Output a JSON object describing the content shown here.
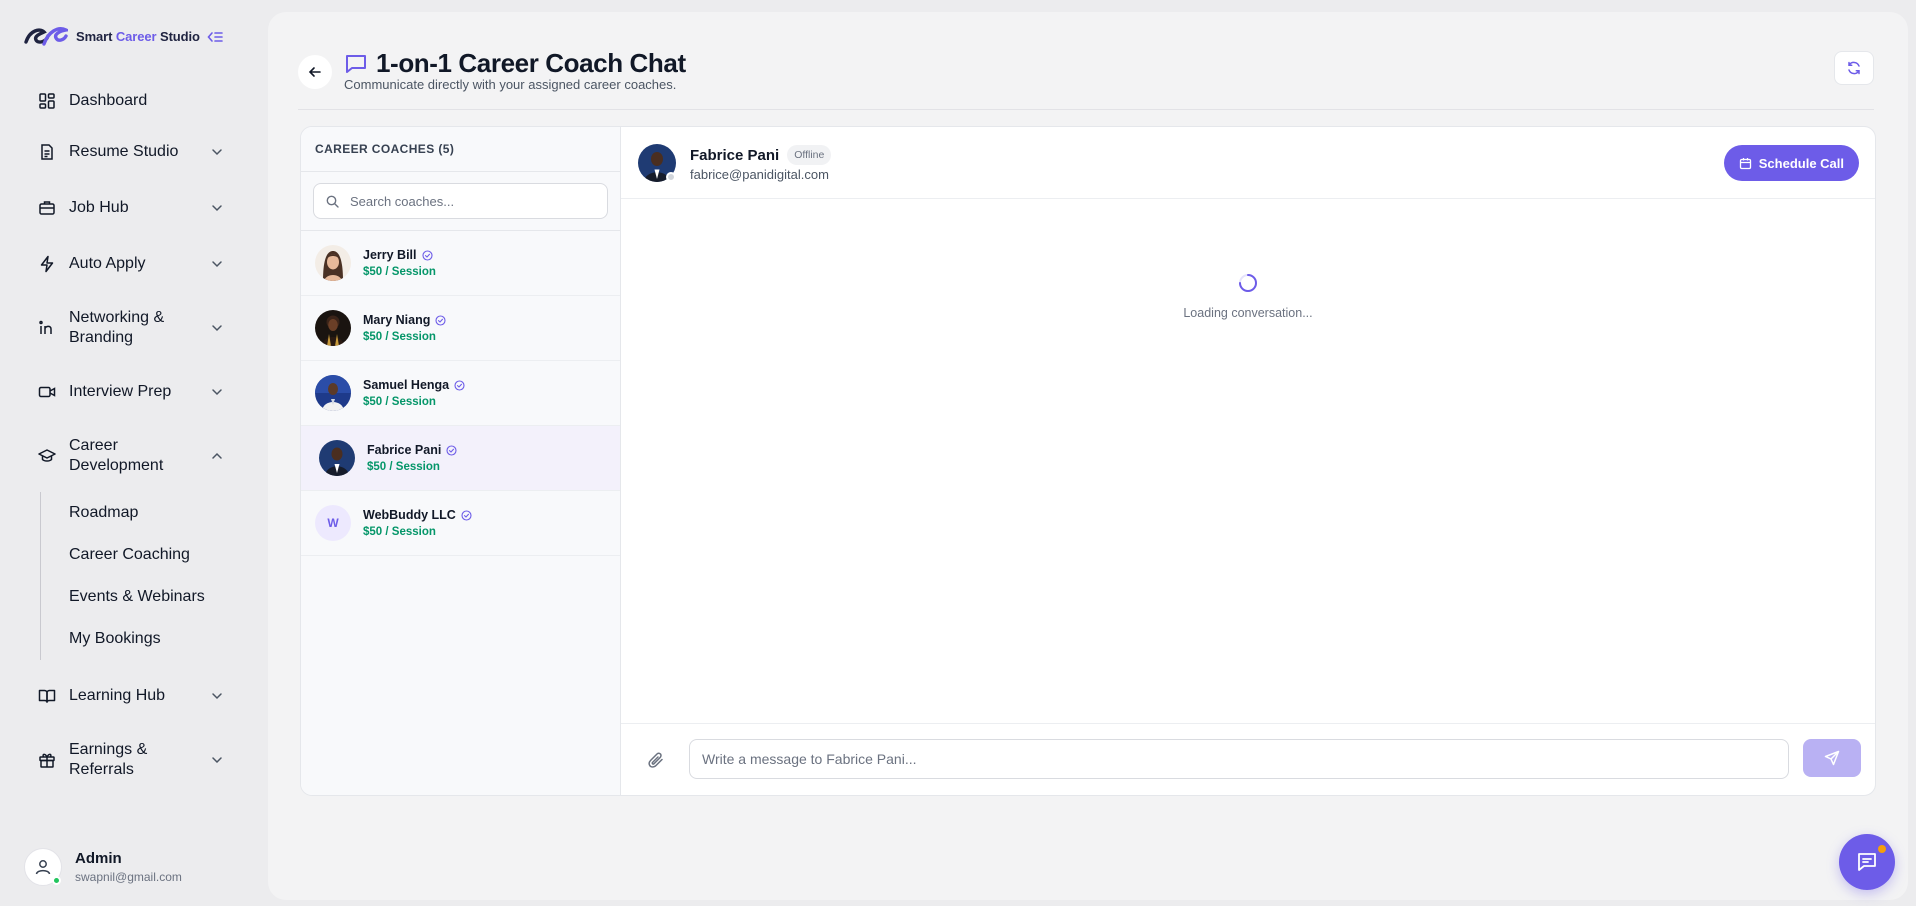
{
  "brand": {
    "name_part1": "Smart ",
    "name_part2": "Career",
    "name_part3": " Studio",
    "accent": "#6d5ce8"
  },
  "sidebar": {
    "items": [
      {
        "label": "Dashboard",
        "icon": "dashboard-icon",
        "expandable": false
      },
      {
        "label": "Resume Studio",
        "icon": "document-icon",
        "expandable": true
      },
      {
        "label": "Job Hub",
        "icon": "briefcase-icon",
        "expandable": true
      },
      {
        "label": "Auto Apply",
        "icon": "lightning-icon",
        "expandable": true
      },
      {
        "label": "Networking & Branding",
        "icon": "linkedin-icon",
        "expandable": true
      },
      {
        "label": "Interview Prep",
        "icon": "video-icon",
        "expandable": true
      },
      {
        "label": "Career Development",
        "icon": "graduation-cap-icon",
        "expandable": true,
        "expanded": true
      },
      {
        "label": "Learning Hub",
        "icon": "book-icon",
        "expandable": true
      },
      {
        "label": "Earnings & Referrals",
        "icon": "gift-icon",
        "expandable": true
      }
    ],
    "career_development_sub": [
      "Roadmap",
      "Career Coaching",
      "Events & Webinars",
      "My Bookings"
    ]
  },
  "profile": {
    "name": "Admin",
    "email": "swapnil@gmail.com",
    "status": "online"
  },
  "page": {
    "title": "1-on-1 Career Coach Chat",
    "subtitle": "Communicate directly with your assigned career coaches."
  },
  "coaches": {
    "heading": "CAREER COACHES (5)",
    "search_placeholder": "Search coaches...",
    "list": [
      {
        "name": "Jerry Bill",
        "price": "$50 / Session",
        "avatar": "photo"
      },
      {
        "name": "Mary Niang",
        "price": "$50 / Session",
        "avatar": "photo"
      },
      {
        "name": "Samuel Henga",
        "price": "$50 / Session",
        "avatar": "photo"
      },
      {
        "name": "Fabrice Pani",
        "price": "$50 / Session",
        "avatar": "photo",
        "active": true
      },
      {
        "name": "WebBuddy LLC",
        "price": "$50 / Session",
        "avatar": "initial",
        "initial": "W"
      }
    ]
  },
  "chat": {
    "name": "Fabrice Pani",
    "status": "Offline",
    "email": "fabrice@panidigital.com",
    "schedule_label": "Schedule Call",
    "loading_text": "Loading conversation...",
    "message_placeholder": "Write a message to Fabrice Pani..."
  },
  "colors": {
    "accent": "#6d5ce8",
    "price": "#059669",
    "send_disabled": "#b9b1f3"
  }
}
